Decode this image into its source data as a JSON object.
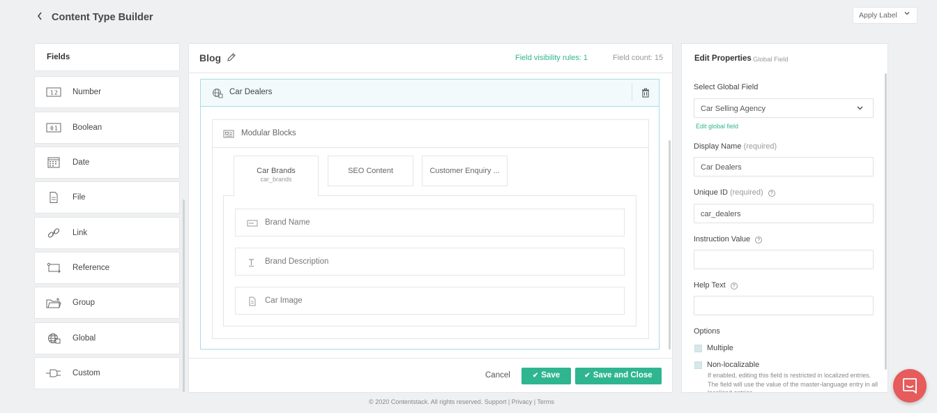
{
  "header": {
    "back_icon": "chevron-left-icon",
    "title": "Content Type Builder",
    "apply_label": "Apply Label"
  },
  "fields_panel": {
    "title": "Fields",
    "items": [
      {
        "label": "Number",
        "icon": "number-icon"
      },
      {
        "label": "Boolean",
        "icon": "boolean-icon"
      },
      {
        "label": "Date",
        "icon": "calendar-icon"
      },
      {
        "label": "File",
        "icon": "file-icon"
      },
      {
        "label": "Link",
        "icon": "link-icon"
      },
      {
        "label": "Reference",
        "icon": "reference-icon"
      },
      {
        "label": "Group",
        "icon": "folder-icon"
      },
      {
        "label": "Global",
        "icon": "globe-icon"
      },
      {
        "label": "Custom",
        "icon": "plug-icon"
      }
    ]
  },
  "builder": {
    "title": "Blog",
    "visibility_rules": "Field visibility rules: 1",
    "field_count": "Field count: 15",
    "global_field": {
      "label": "Car Dealers",
      "modular_blocks": {
        "label": "Modular Blocks",
        "tabs": [
          {
            "label": "Car Brands",
            "sub": "car_brands"
          },
          {
            "label": "SEO Content"
          },
          {
            "label": "Customer Enquiry ..."
          }
        ],
        "fields": [
          {
            "label": "Brand Name",
            "icon": "single-line-text-icon"
          },
          {
            "label": "Brand Description",
            "icon": "text-icon"
          },
          {
            "label": "Car Image",
            "icon": "file-icon"
          }
        ]
      }
    },
    "footer": {
      "cancel": "Cancel",
      "save": "Save",
      "save_close": "Save and Close"
    }
  },
  "properties": {
    "title": "Edit Properties",
    "subtitle": "Global Field",
    "select_label": "Select Global Field",
    "select_value": "Car Selling Agency",
    "edit_link": "Edit global field",
    "display_name_label": "Display Name",
    "display_name_req": "(required)",
    "display_name_value": "Car Dealers",
    "unique_id_label": "Unique ID",
    "unique_id_req": "(required)",
    "unique_id_value": "car_dealers",
    "instruction_label": "Instruction Value",
    "instruction_value": "",
    "help_label": "Help Text",
    "help_value": "",
    "options_label": "Options",
    "opt_multiple": "Multiple",
    "opt_nonlocal": "Non-localizable",
    "opt_nonlocal_note": "If enabled, editing this field is restricted in localized entries. The field will use the value of the master-language entry in all localized entries."
  },
  "footer": {
    "copyright": "© 2020 Contentstack. All rights reserved.",
    "support": "Support",
    "privacy": "Privacy",
    "terms": "Terms"
  },
  "colors": {
    "accent": "#2fb58f",
    "chat": "#e65b5b",
    "global_border": "#a9dbe8"
  }
}
